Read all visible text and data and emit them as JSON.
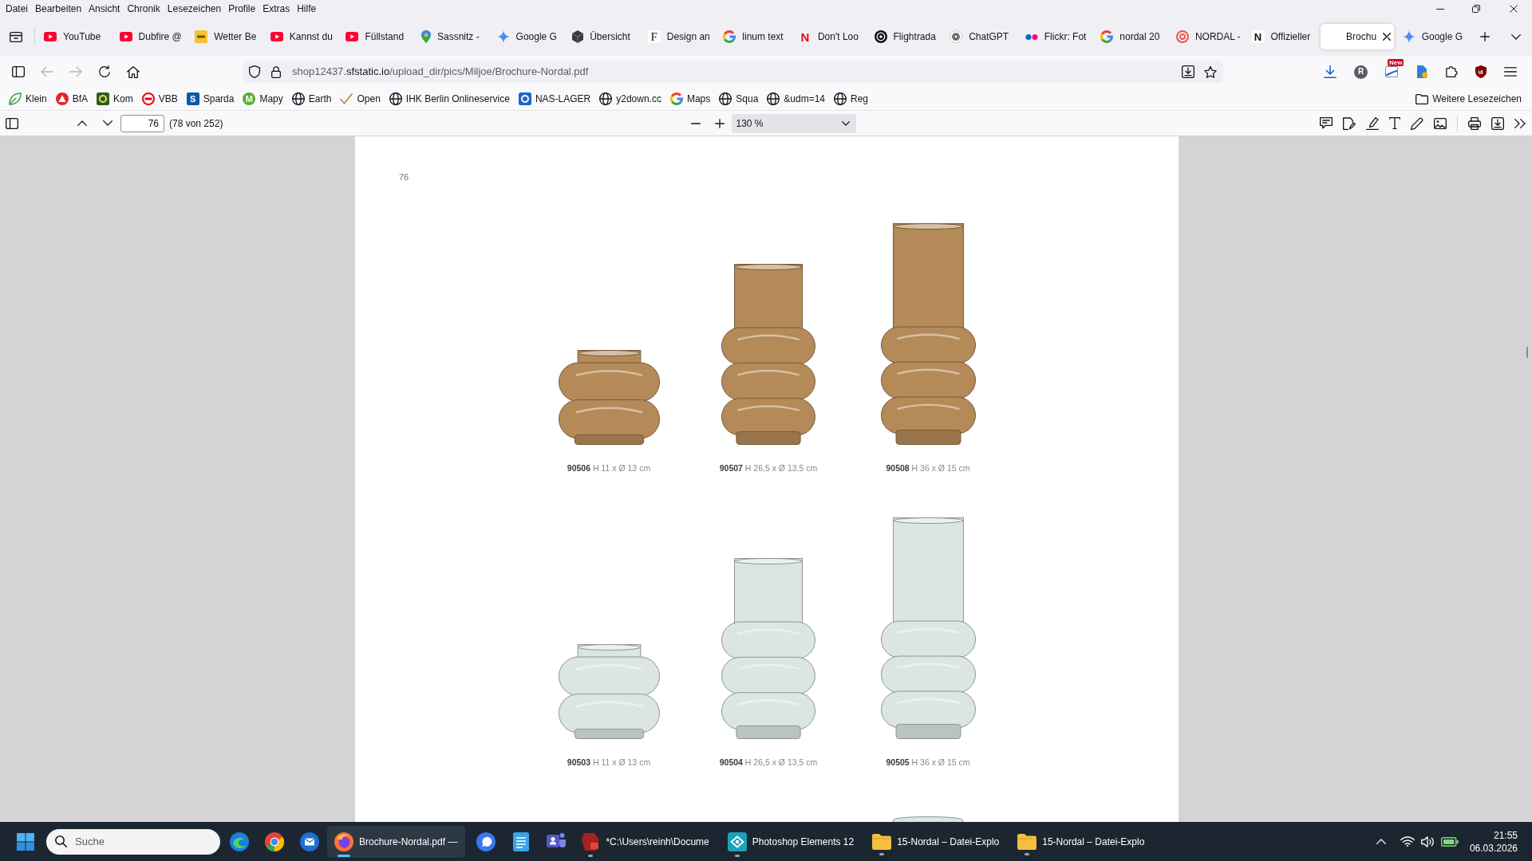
{
  "menu": [
    "Datei",
    "Bearbeiten",
    "Ansicht",
    "Chronik",
    "Lesezeichen",
    "Profile",
    "Extras",
    "Hilfe"
  ],
  "tabs": [
    {
      "title": "YouTube",
      "kind": "play",
      "selected": false
    },
    {
      "title": "Dubfire @",
      "kind": "play",
      "selected": false
    },
    {
      "title": "Wetter Be",
      "kind": "tile",
      "selected": false
    },
    {
      "title": "Kannst du",
      "kind": "play",
      "selected": false
    },
    {
      "title": "Füllstand",
      "kind": "play",
      "selected": false
    },
    {
      "title": "Sassnitz -",
      "kind": "pin",
      "selected": false
    },
    {
      "title": "Google G",
      "kind": "sparkle",
      "selected": false
    },
    {
      "title": "Übersicht",
      "kind": "cube",
      "selected": false
    },
    {
      "title": "Design an",
      "kind": "serif",
      "icon_text": "F",
      "selected": false
    },
    {
      "title": "linum text",
      "kind": "g",
      "selected": false
    },
    {
      "title": "Don't Loo",
      "kind": "redletter",
      "icon_text": "N",
      "selected": false
    },
    {
      "title": "Flightrada",
      "kind": "radar",
      "selected": false
    },
    {
      "title": "ChatGPT",
      "kind": "knot",
      "selected": false
    },
    {
      "title": "Flickr: Fot",
      "kind": "dots",
      "selected": false
    },
    {
      "title": "nordal 20",
      "kind": "g",
      "selected": false
    },
    {
      "title": "NORDAL -",
      "kind": "target",
      "selected": false
    },
    {
      "title": "Offizieller",
      "kind": "letter",
      "icon_text": "N",
      "selected": false
    },
    {
      "title": "Brochu",
      "kind": "blank",
      "selected": true
    },
    {
      "title": "Google G",
      "kind": "sparkle",
      "selected": false
    }
  ],
  "nav_buttons": [
    {
      "kind": "back",
      "disabled": true
    },
    {
      "kind": "forward",
      "disabled": true
    },
    {
      "kind": "reload",
      "disabled": false
    },
    {
      "kind": "home",
      "disabled": false
    }
  ],
  "address_bar": {
    "url": "shop12437.**sfstatic.io**/upload_dir/pics/Miljoe/Brochure-Nordal.pdf"
  },
  "toolbar": {
    "profile_letter": "R",
    "extension_badge": "New"
  },
  "bookmarks": [
    {
      "label": "Klein",
      "kind": "leaf"
    },
    {
      "label": "BfA",
      "kind": "triangle"
    },
    {
      "label": "Kom",
      "kind": "frame"
    },
    {
      "label": "VBB",
      "kind": "ring"
    },
    {
      "label": "Sparda",
      "kind": "square",
      "icon_text": "S"
    },
    {
      "label": "Mapy",
      "kind": "circle",
      "icon_text": "M"
    },
    {
      "label": "Earth",
      "kind": "globe"
    },
    {
      "label": "Open",
      "kind": "tick"
    },
    {
      "label": "IHK Berlin Onlineservice",
      "kind": "globe"
    },
    {
      "label": "NAS-LAGER",
      "kind": "box"
    },
    {
      "label": "y2down.cc",
      "kind": "globe"
    },
    {
      "label": "Maps",
      "kind": "g"
    },
    {
      "label": "Squa",
      "kind": "globe"
    },
    {
      "label": "&udm=14",
      "kind": "globe"
    },
    {
      "label": "Reg",
      "kind": "globe"
    }
  ],
  "other_bookmarks": "Weitere Lesezeichen",
  "pdf_toolbar": {
    "page": "76",
    "page_count": "(78 von 252)",
    "zoom": "130 %"
  },
  "page": {
    "page_number": "76",
    "rows": [
      {
        "items": [
          {
            "kind": "small",
            "color": "#b48a58",
            "caption": "**90506** H 11 x Ø 13 cm"
          },
          {
            "kind": "medium",
            "color": "#b48a58",
            "caption": "**90507** H 26,5 x Ø 13,5 cm"
          },
          {
            "kind": "tall",
            "color": "#b48a58",
            "caption": "**90508** H 36 x Ø 15 cm"
          }
        ]
      },
      {
        "items": [
          {
            "kind": "small",
            "color": "#dbe6e1",
            "caption": "**90503** H 11 x Ø 13 cm"
          },
          {
            "kind": "medium",
            "color": "#dbe6e1",
            "caption": "**90504** H 26,5 x Ø 13,5 cm"
          },
          {
            "kind": "tall",
            "color": "#dbe6e1",
            "caption": "**90505** H 36 x Ø 15 cm"
          }
        ]
      }
    ],
    "next_row": {
      "kind": "tall",
      "color": "#dbe6e1"
    }
  },
  "taskbar": {
    "search": {
      "placeholder": "Suche"
    },
    "apps": [
      {
        "kind": "edge",
        "running": false,
        "active": false
      },
      {
        "kind": "chrome",
        "running": false,
        "active": false
      },
      {
        "kind": "mail",
        "running": false,
        "active": false
      },
      {
        "kind": "firefox",
        "label": "Brochure-Nordal.pdf —",
        "running": true,
        "active": true
      },
      {
        "kind": "signal",
        "running": false,
        "active": false
      },
      {
        "kind": "notepad",
        "running": false,
        "active": false
      },
      {
        "kind": "teams",
        "running": false,
        "active": false
      },
      {
        "kind": "app",
        "label": "*C:\\Users\\reinh\\Docume",
        "running": true,
        "active": false
      },
      {
        "kind": "photo",
        "label": "Photoshop Elements 12",
        "running": true,
        "active": false
      },
      {
        "kind": "folder",
        "label": "15-Nordal – Datei-Explo",
        "running": true,
        "active": false
      },
      {
        "kind": "folder",
        "label": "15-Nordal – Datei-Explo",
        "running": true,
        "active": false
      }
    ],
    "time": "21:55",
    "date": "06.03.2026"
  }
}
